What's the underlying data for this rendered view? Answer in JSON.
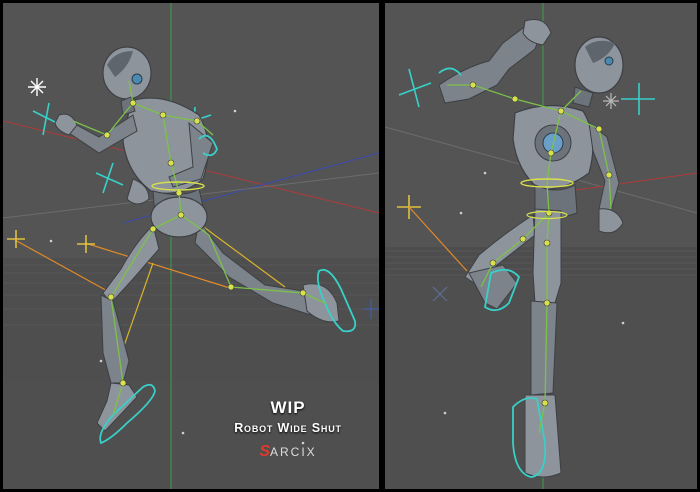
{
  "caption": {
    "title": "WIP",
    "subtitle": "Robot Wide Shut",
    "logo_mark": "S",
    "logo_text": "ARCIX"
  },
  "colors": {
    "viewport_bg": "#525252",
    "floor_bg": "#474747",
    "border": "#000000",
    "robot_metal": "#8e949b",
    "robot_dark": "#5f656c",
    "joint_yellow": "#d8e04a",
    "bone_green": "#7cc24a",
    "ik_orange": "#e08a2a",
    "cyan_control": "#38d0c8",
    "axis_red": "#b03a3a",
    "axis_blue": "#3a4ab0",
    "axis_green": "#3aa04a",
    "logo_red": "#e23a2a"
  },
  "viewports": [
    {
      "id": "left",
      "label": "viewport-front-run-pose"
    },
    {
      "id": "right",
      "label": "viewport-jump-pose"
    }
  ]
}
